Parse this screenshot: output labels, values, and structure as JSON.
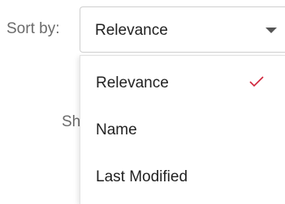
{
  "sort": {
    "label": "Sort by:",
    "selected": "Relevance",
    "options": [
      {
        "label": "Relevance",
        "selected": true
      },
      {
        "label": "Name",
        "selected": false
      },
      {
        "label": "Last Modified",
        "selected": false
      }
    ]
  },
  "background": {
    "partial_text": "Sh"
  },
  "icons": {
    "dropdown": "caret-down-icon",
    "selected": "check-icon"
  },
  "colors": {
    "check": "#d0243a",
    "text": "#222222",
    "label": "#6b6b6b",
    "border": "#cfcfcf"
  }
}
